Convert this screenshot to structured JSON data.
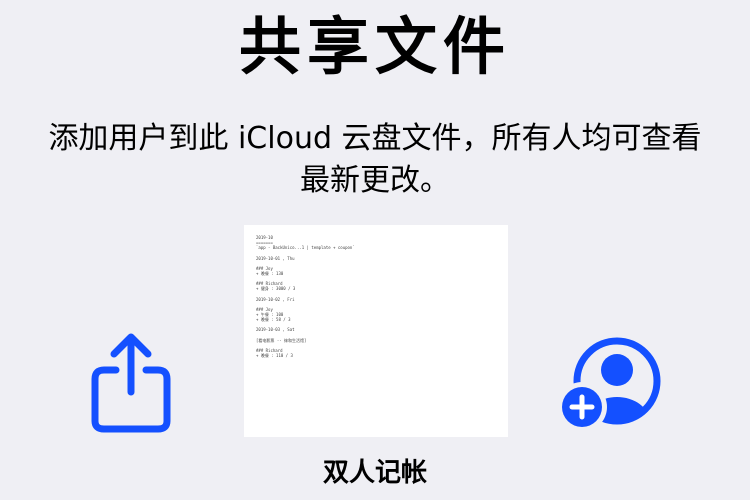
{
  "header": {
    "title": "共享文件"
  },
  "description": {
    "text": "添加用户到此 iCloud 云盘文件，所有人均可查看最新更改。"
  },
  "actions": {
    "share_icon": "square-and-arrow-up-icon",
    "add_people_icon": "person-crop-circle-badge-plus-icon",
    "accent_color": "#1450ff"
  },
  "document": {
    "name": "双人记帐",
    "preview_lines": [
      "2019-10",
      "=======",
      "`app - BackUnico...1 | template + coupon`",
      "",
      "2019-10-01 , Thu",
      "",
      "### Joy",
      "+ 晚餐 : 130",
      "",
      "### Richard",
      "+ 健身 : 3000 / 3",
      "",
      "2019-10-02 , Fri",
      "",
      "### Joy",
      "+ 午餐 : 100",
      "+ 晚餐 : 58 / 3",
      "",
      "2019-10-03 , Sat",
      "",
      "[看电影票 -- 徕和生活馆]",
      "",
      "### Richard",
      "+ 晚餐 : 110 / 3"
    ]
  }
}
